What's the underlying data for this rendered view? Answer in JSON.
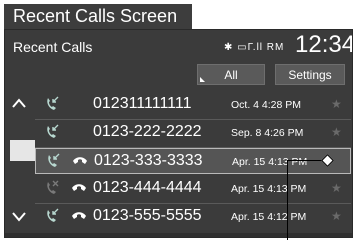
{
  "caption": "Recent Calls Screen",
  "header": {
    "title": "Recent Calls",
    "status_icons": "✱ ▭Г.ll RM",
    "clock": "12:34"
  },
  "tabs": {
    "all": "All",
    "settings": "Settings"
  },
  "calls": [
    {
      "number": "012311111111",
      "date": "Oct. 4 4:28 PM",
      "type": "incoming",
      "phone_icon": false
    },
    {
      "number": "0123-222-2222",
      "date": "Sep. 8 4:26 PM",
      "type": "incoming",
      "phone_icon": false
    },
    {
      "number": "0123-333-3333",
      "date": "Apr. 15 4:13 PM",
      "type": "incoming",
      "phone_icon": true,
      "selected": true
    },
    {
      "number": "0123-444-4444",
      "date": "Apr. 15 4:13 PM",
      "type": "missed",
      "phone_icon": true
    },
    {
      "number": "0123-555-5555",
      "date": "Apr. 15 4:12 PM",
      "type": "incoming",
      "phone_icon": true
    }
  ],
  "colors": {
    "screen_bg": "#3b3b3b",
    "icon_active": "#b8d8d0",
    "icon_dim": "#7a7a7a",
    "star": "#6a6a6a"
  }
}
